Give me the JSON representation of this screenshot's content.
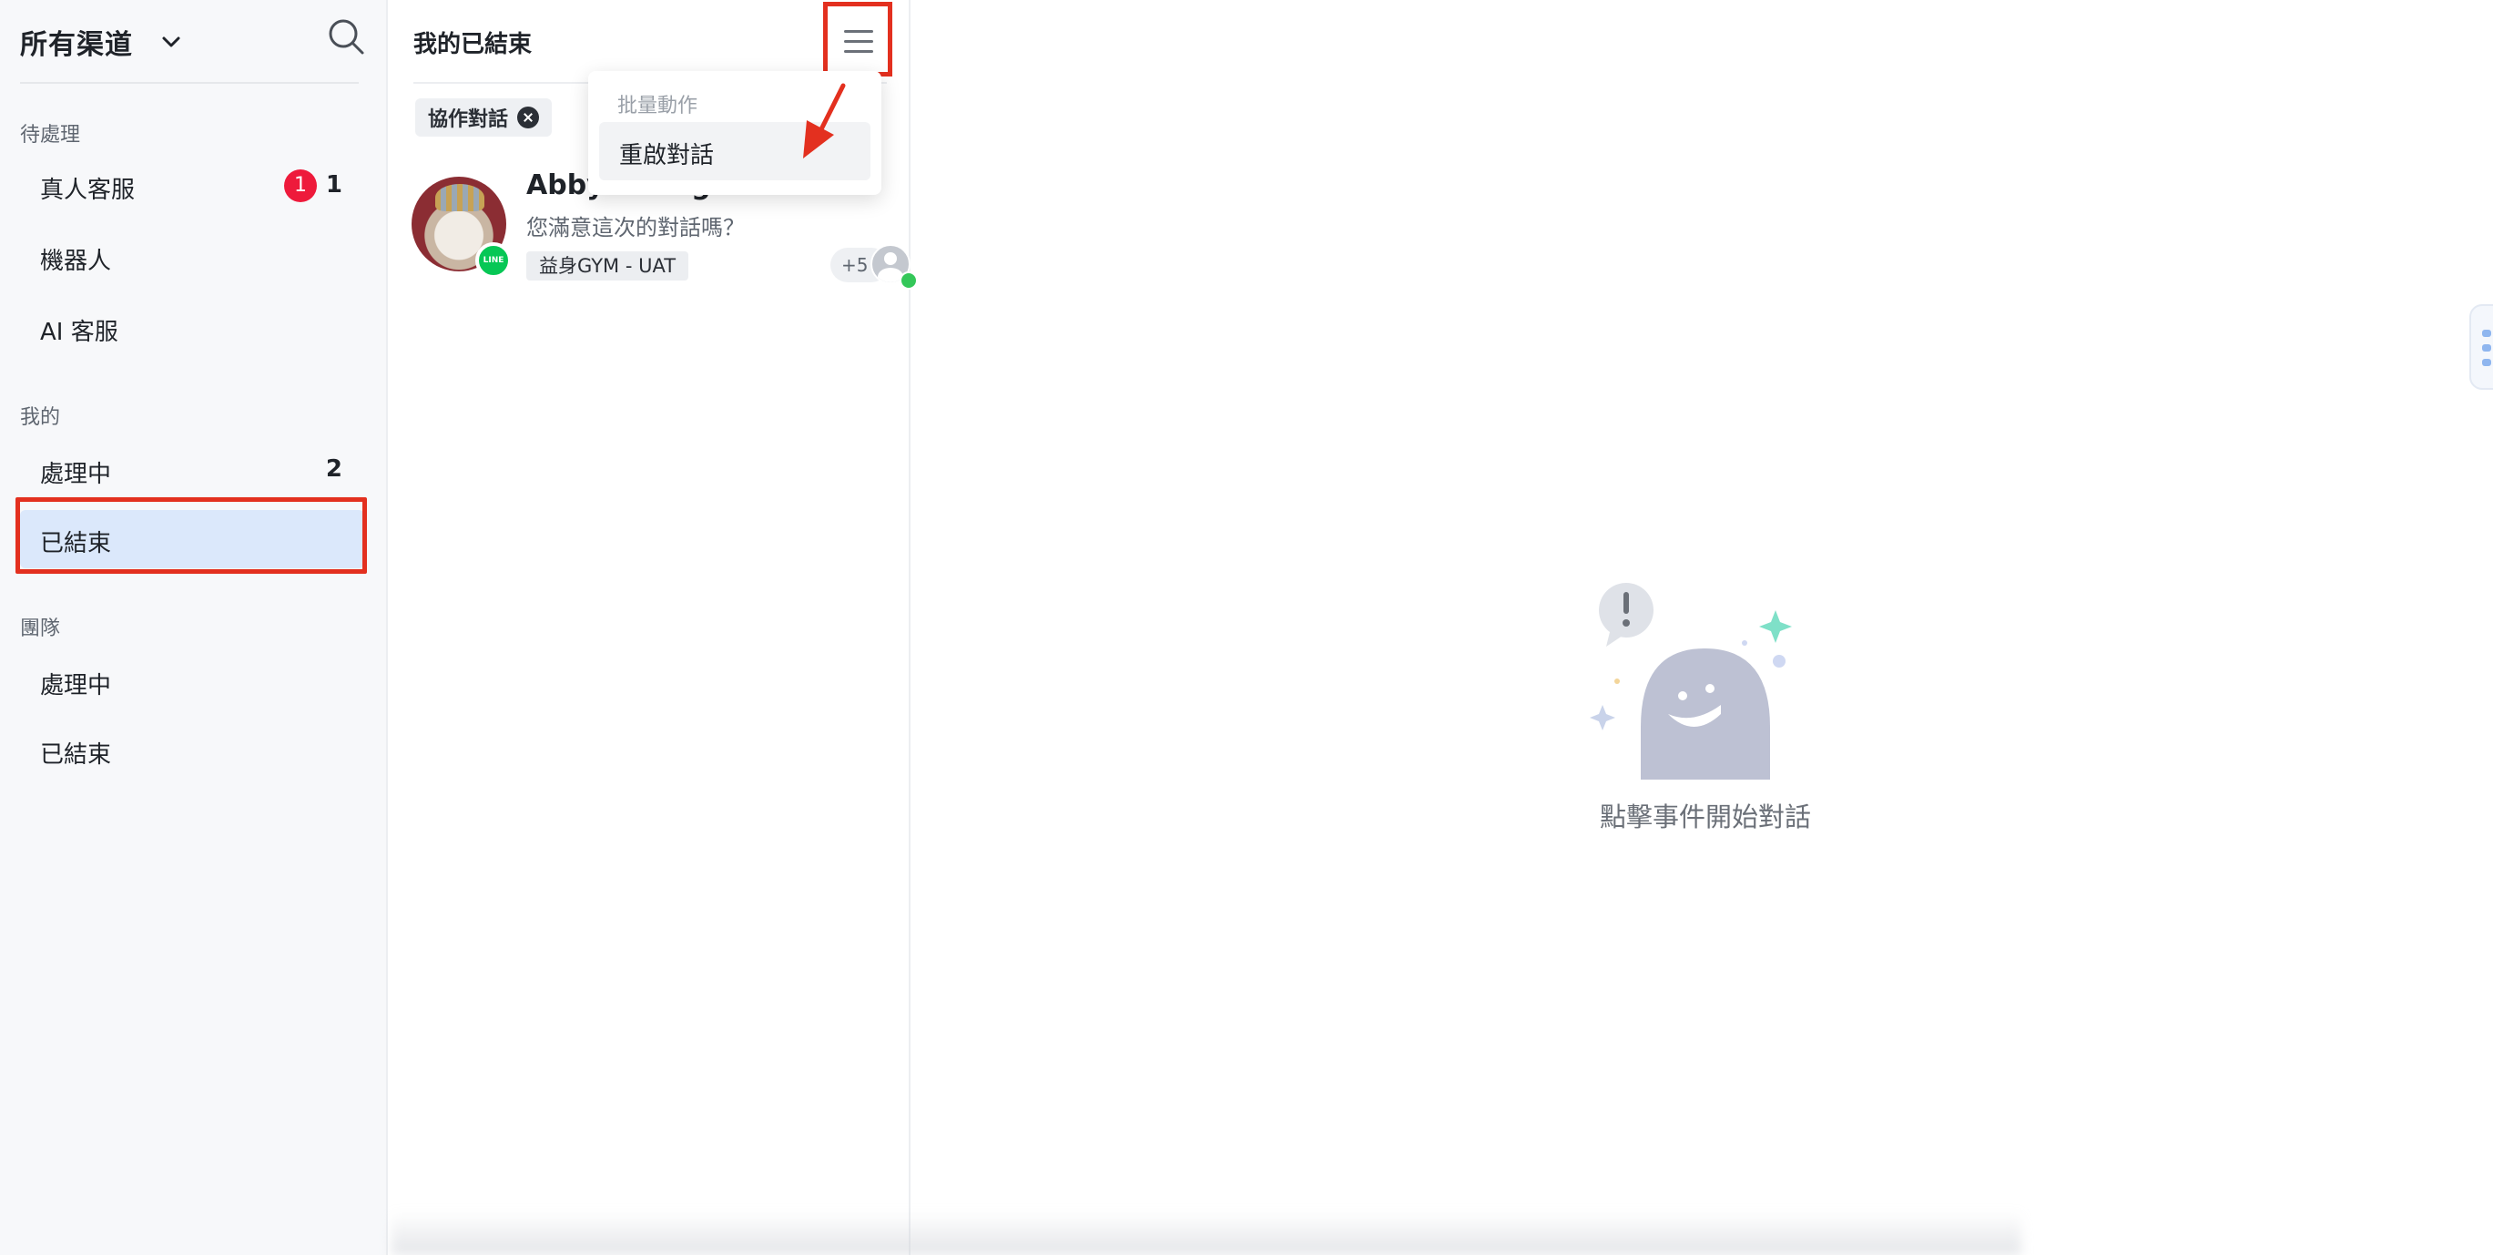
{
  "sidebar": {
    "channel_title": "所有渠道",
    "sections": {
      "pending": {
        "label": "待處理",
        "items": [
          {
            "label": "真人客服",
            "badge": "1",
            "count": "1"
          },
          {
            "label": "機器人"
          },
          {
            "label": "AI 客服"
          }
        ]
      },
      "mine": {
        "label": "我的",
        "items": [
          {
            "label": "處理中",
            "count": "2"
          },
          {
            "label": "已結束"
          }
        ]
      },
      "team": {
        "label": "團隊",
        "items": [
          {
            "label": "處理中"
          },
          {
            "label": "已結束"
          }
        ]
      }
    }
  },
  "list": {
    "title": "我的已結束",
    "filter_chip": "協作對話",
    "conversations": [
      {
        "name": "Abby Chang",
        "preview": "您滿意這次的對話嗎？",
        "tag": "益身GYM - UAT",
        "extra_assignees": "+5",
        "channel_icon": "line-icon"
      }
    ]
  },
  "dropdown": {
    "header": "批量動作",
    "items": [
      {
        "label": "重啟對話"
      }
    ]
  },
  "main": {
    "empty_text": "點擊事件開始對話"
  },
  "colors": {
    "accent_red": "#e3301f",
    "badge_red": "#ee1a3b",
    "active_blue": "#dbe8fb",
    "line_green": "#06c755"
  }
}
